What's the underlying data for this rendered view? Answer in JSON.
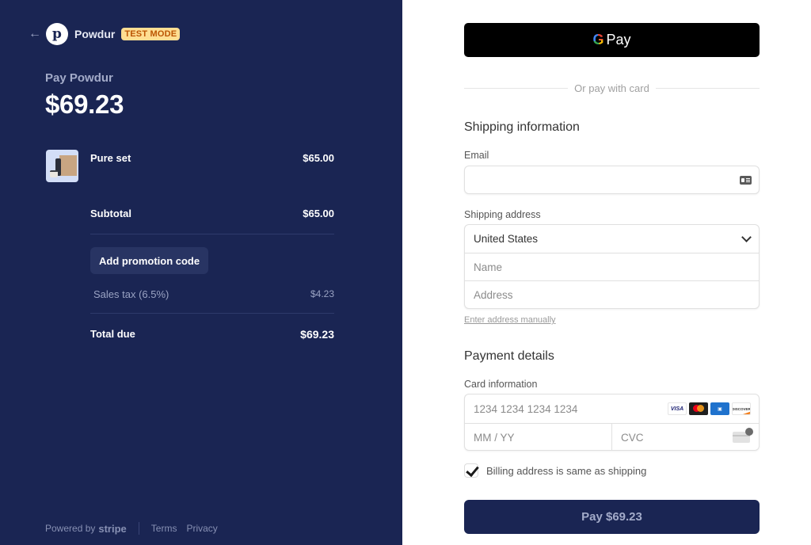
{
  "merchant": {
    "name": "Powdur",
    "logo_letter": "p",
    "badge": "TEST MODE",
    "back_icon": "arrow-left-icon"
  },
  "summary": {
    "pay_label": "Pay Powdur",
    "amount": "$69.23",
    "items": [
      {
        "name": "Pure set",
        "price": "$65.00",
        "thumbnail": "product-image"
      }
    ],
    "subtotal_label": "Subtotal",
    "subtotal_value": "$65.00",
    "promo_label": "Add promotion code",
    "tax_label": "Sales tax (6.5%)",
    "tax_value": "$4.23",
    "total_label": "Total due",
    "total_value": "$69.23"
  },
  "footer": {
    "powered_by": "Powered by",
    "stripe": "stripe",
    "terms": "Terms",
    "privacy": "Privacy"
  },
  "checkout": {
    "gpay_label": "Pay",
    "gpay_g": "G",
    "divider_text": "Or pay with card",
    "shipping_title": "Shipping information",
    "email_label": "Email",
    "email_value": "",
    "shipping_address_label": "Shipping address",
    "country_value": "United States",
    "name_placeholder": "Name",
    "address_placeholder": "Address",
    "manual_link": "Enter address manually",
    "payment_title": "Payment details",
    "card_info_label": "Card information",
    "card_number_placeholder": "1234 1234 1234 1234",
    "expiry_placeholder": "MM / YY",
    "cvc_placeholder": "CVC",
    "card_brands": [
      "VISA",
      "Mastercard",
      "AMEX",
      "DISCOVER"
    ],
    "billing_same_label": "Billing address is same as shipping",
    "billing_same_checked": true,
    "pay_button": "Pay $69.23"
  },
  "colors": {
    "sidebar_bg": "#1a2553",
    "badge_bg": "#ffde92",
    "badge_text": "#bb5504",
    "pay_button_bg": "#1a2553"
  }
}
